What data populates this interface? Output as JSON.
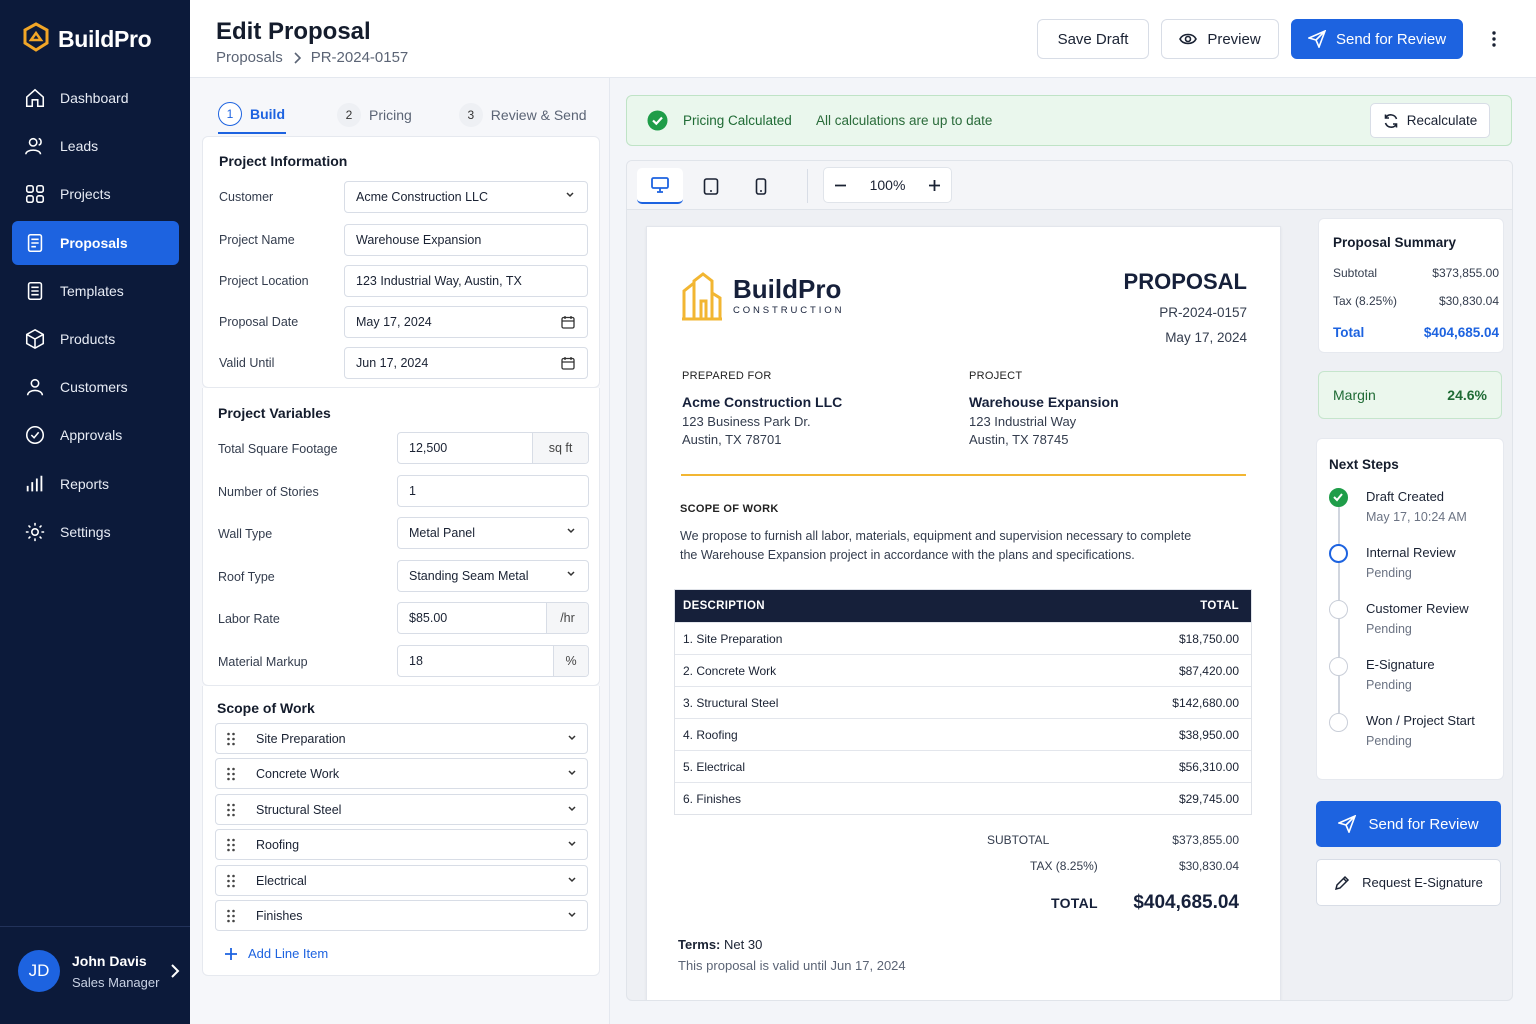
{
  "app": {
    "name": "BuildPro"
  },
  "sidebar": {
    "items": [
      {
        "label": "Dashboard",
        "icon": "home-icon"
      },
      {
        "label": "Leads",
        "icon": "users-icon"
      },
      {
        "label": "Projects",
        "icon": "grid-icon"
      },
      {
        "label": "Proposals",
        "icon": "document-icon",
        "active": true
      },
      {
        "label": "Templates",
        "icon": "template-icon"
      },
      {
        "label": "Products",
        "icon": "box-icon"
      },
      {
        "label": "Customers",
        "icon": "user-icon"
      },
      {
        "label": "Approvals",
        "icon": "check-circle-icon"
      },
      {
        "label": "Reports",
        "icon": "bar-chart-icon"
      },
      {
        "label": "Settings",
        "icon": "gear-icon"
      }
    ],
    "user": {
      "initials": "JD",
      "name": "John Davis",
      "role": "Sales Manager"
    }
  },
  "header": {
    "title": "Edit Proposal",
    "breadcrumb": [
      "Proposals",
      "PR-2024-0157"
    ],
    "save_draft": "Save Draft",
    "preview": "Preview",
    "send_review": "Send for Review"
  },
  "wizard": {
    "steps": [
      {
        "num": "1",
        "label": "Build",
        "active": true
      },
      {
        "num": "2",
        "label": "Pricing"
      },
      {
        "num": "3",
        "label": "Review & Send"
      }
    ]
  },
  "project_info": {
    "title": "Project Information",
    "fields": {
      "customer": {
        "label": "Customer",
        "value": "Acme Construction LLC"
      },
      "project_name": {
        "label": "Project Name",
        "value": "Warehouse Expansion"
      },
      "project_location": {
        "label": "Project Location",
        "value": "123 Industrial Way, Austin, TX"
      },
      "proposal_date": {
        "label": "Proposal Date",
        "value": "May 17, 2024"
      },
      "valid_until": {
        "label": "Valid Until",
        "value": "Jun 17, 2024"
      }
    }
  },
  "project_vars": {
    "title": "Project Variables",
    "fields": {
      "sqft": {
        "label": "Total Square Footage",
        "value": "12,500",
        "unit": "sq ft"
      },
      "stories": {
        "label": "Number of Stories",
        "value": "1"
      },
      "wall": {
        "label": "Wall Type",
        "value": "Metal Panel"
      },
      "roof": {
        "label": "Roof Type",
        "value": "Standing Seam Metal"
      },
      "labor": {
        "label": "Labor Rate",
        "value": "$85.00",
        "unit": "/hr"
      },
      "markup": {
        "label": "Material Markup",
        "value": "18",
        "unit": "%"
      }
    }
  },
  "scope": {
    "title": "Scope of Work",
    "items": [
      "Site Preparation",
      "Concrete Work",
      "Structural Steel",
      "Roofing",
      "Electrical",
      "Finishes"
    ],
    "add_label": "Add Line Item"
  },
  "banner": {
    "title": "Pricing Calculated",
    "subtitle": "All calculations are up to date",
    "recalc": "Recalculate",
    "color": "#1f9d49"
  },
  "preview_toolbar": {
    "zoom": "100%"
  },
  "document": {
    "logo_main": "BuildPro",
    "logo_sub": "CONSTRUCTION",
    "title": "PROPOSAL",
    "number": "PR-2024-0157",
    "date": "May 17, 2024",
    "prepared_for": {
      "label": "PREPARED FOR",
      "name": "Acme Construction LLC",
      "line1": "123 Business Park Dr.",
      "line2": "Austin, TX 78701"
    },
    "project": {
      "label": "PROJECT",
      "name": "Warehouse Expansion",
      "line1": "123 Industrial Way",
      "line2": "Austin, TX 78745"
    },
    "scope_heading": "SCOPE OF WORK",
    "scope_line1": "We propose to furnish all labor, materials, equipment and supervision necessary to complete",
    "scope_line2": "the Warehouse Expansion project in accordance with the plans and specifications.",
    "table": {
      "col_desc": "DESCRIPTION",
      "col_total": "TOTAL",
      "rows": [
        {
          "desc": "1. Site Preparation",
          "total": "$18,750.00"
        },
        {
          "desc": "2. Concrete Work",
          "total": "$87,420.00"
        },
        {
          "desc": "3. Structural Steel",
          "total": "$142,680.00"
        },
        {
          "desc": "4. Roofing",
          "total": "$38,950.00"
        },
        {
          "desc": "5. Electrical",
          "total": "$56,310.00"
        },
        {
          "desc": "6. Finishes",
          "total": "$29,745.00"
        }
      ]
    },
    "subtotal_label": "SUBTOTAL",
    "subtotal": "$373,855.00",
    "tax_label": "TAX (8.25%)",
    "tax": "$30,830.04",
    "total_label": "TOTAL",
    "total": "$404,685.04",
    "terms_label": "Terms:",
    "terms_value": "Net 30",
    "validity": "This proposal is valid until Jun 17, 2024",
    "accent_color": "#f2b632"
  },
  "summary": {
    "title": "Proposal Summary",
    "subtotal_label": "Subtotal",
    "subtotal": "$373,855.00",
    "tax_label": "Tax (8.25%)",
    "tax": "$30,830.04",
    "total_label": "Total",
    "total": "$404,685.04",
    "margin_label": "Margin",
    "margin": "24.6%"
  },
  "next_steps": {
    "title": "Next Steps",
    "items": [
      {
        "name": "Draft Created",
        "sub": "May 17, 10:24 AM",
        "state": "done"
      },
      {
        "name": "Internal Review",
        "sub": "Pending",
        "state": "current"
      },
      {
        "name": "Customer Review",
        "sub": "Pending",
        "state": "pending"
      },
      {
        "name": "E-Signature",
        "sub": "Pending",
        "state": "pending"
      },
      {
        "name": "Won / Project Start",
        "sub": "Pending",
        "state": "pending"
      }
    ]
  },
  "actions": {
    "send_review": "Send for Review",
    "esign": "Request E-Signature"
  },
  "colors": {
    "accent": "#1d63e0",
    "sidebar": "#0c1a3a",
    "success": "#1f9d49"
  }
}
